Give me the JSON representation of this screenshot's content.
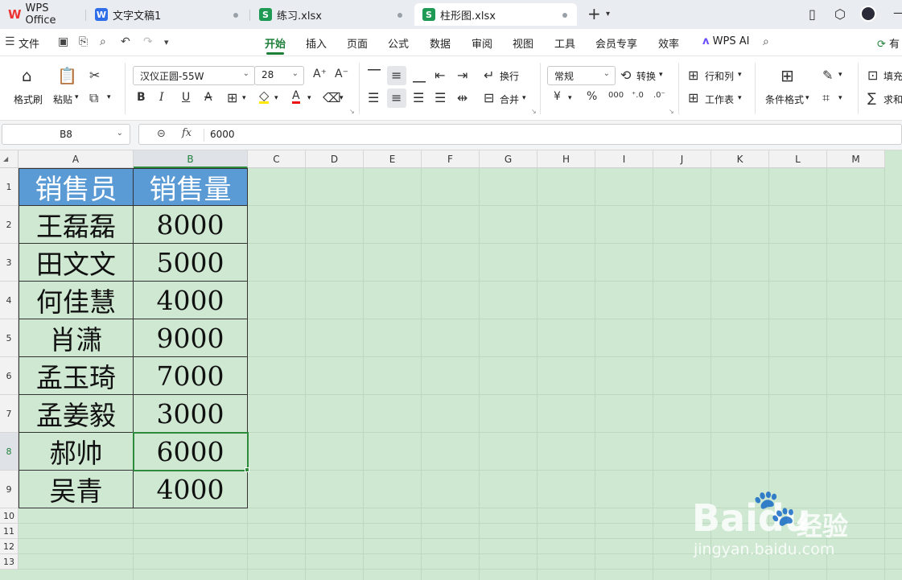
{
  "tabs": [
    {
      "label": "WPS Office",
      "icon": "wps-logo-icon"
    },
    {
      "label": "文字文稿1",
      "icon": "word-doc-icon",
      "icon_text": "W"
    },
    {
      "label": "练习.xlsx",
      "icon": "spreadsheet-icon",
      "icon_text": "S"
    },
    {
      "label": "柱形图.xlsx",
      "icon": "spreadsheet-icon",
      "icon_text": "S"
    }
  ],
  "menu": {
    "file": "文件",
    "items": [
      "开始",
      "插入",
      "页面",
      "公式",
      "数据",
      "审阅",
      "视图",
      "工具",
      "会员专享",
      "效率"
    ],
    "active": "开始",
    "wps_ai": "WPS AI",
    "share": "有"
  },
  "ribbon": {
    "format_painter": "格式刷",
    "paste": "粘贴",
    "font_name": "汉仪正圆-55W",
    "font_size": "28",
    "wrap": "换行",
    "merge": "合并",
    "number_format": "常规",
    "convert": "转换",
    "row_col": "行和列",
    "worksheet": "工作表",
    "cond_format": "条件格式",
    "fill": "填充",
    "sum": "求和"
  },
  "formula_bar": {
    "cell_ref": "B8",
    "fx": "fx",
    "value": "6000"
  },
  "columns": [
    "A",
    "B",
    "C",
    "D",
    "E",
    "F",
    "G",
    "H",
    "I",
    "J",
    "K",
    "L",
    "M"
  ],
  "rows": [
    "1",
    "2",
    "3",
    "4",
    "5",
    "6",
    "7",
    "8",
    "9",
    "10",
    "11",
    "12",
    "13"
  ],
  "table": {
    "headers": [
      "销售员",
      "销售量"
    ],
    "rows": [
      [
        "王磊磊",
        "8000"
      ],
      [
        "田文文",
        "5000"
      ],
      [
        "何佳慧",
        "4000"
      ],
      [
        "肖潇",
        "9000"
      ],
      [
        "孟玉琦",
        "7000"
      ],
      [
        "孟姜毅",
        "3000"
      ],
      [
        "郝帅",
        "6000"
      ],
      [
        "吴青",
        "4000"
      ]
    ]
  },
  "colors": {
    "accent": "#1e7f3a",
    "header_fill": "#5b9bd5",
    "sheet_bg": "#cfe8d2"
  },
  "watermark": {
    "brand": "Baidu",
    "suffix": "经验",
    "url": "jingyan.baidu.com"
  }
}
